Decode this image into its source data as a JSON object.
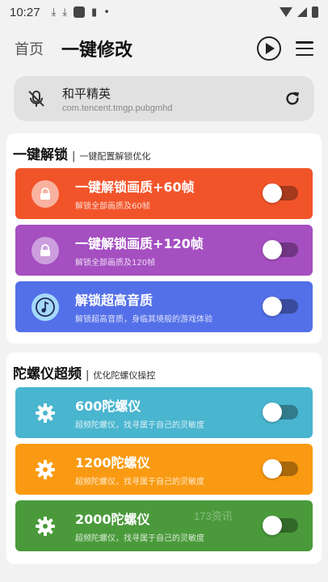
{
  "status": {
    "time": "10:27"
  },
  "header": {
    "home_label": "首页",
    "title": "一键修改"
  },
  "app": {
    "name": "和平精英",
    "package": "com.tencent.tmgp.pubgmhd"
  },
  "sections": [
    {
      "title": "一键解锁",
      "separator": "|",
      "subtitle": "一键配置解锁优化",
      "items": [
        {
          "title": "一键解锁画质+60帧",
          "desc": "解锁全部画质及60帧",
          "color": "#f2542a",
          "enabled": false
        },
        {
          "title": "一键解锁画质+120帧",
          "desc": "解锁全部画质及120帧",
          "color": "#a54fc1",
          "enabled": false
        },
        {
          "title": "解锁超高音质",
          "desc": "解锁超高音质，身临其境般的游戏体验",
          "color": "#5470e8",
          "enabled": false
        }
      ]
    },
    {
      "title": "陀螺仪超频",
      "separator": "|",
      "subtitle": "优化陀螺仪操控",
      "items": [
        {
          "title": "600陀螺仪",
          "desc": "超频陀螺仪，找寻属于自己的灵敏度",
          "color": "#49b5cf",
          "enabled": false
        },
        {
          "title": "1200陀螺仪",
          "desc": "超频陀螺仪，找寻属于自己的灵敏度",
          "color": "#f99a12",
          "enabled": false
        },
        {
          "title": "2000陀螺仪",
          "desc": "超频陀螺仪，找寻属于自己的灵敏度",
          "color": "#4a9a3b",
          "enabled": false
        }
      ]
    }
  ],
  "watermark": "173资讯"
}
